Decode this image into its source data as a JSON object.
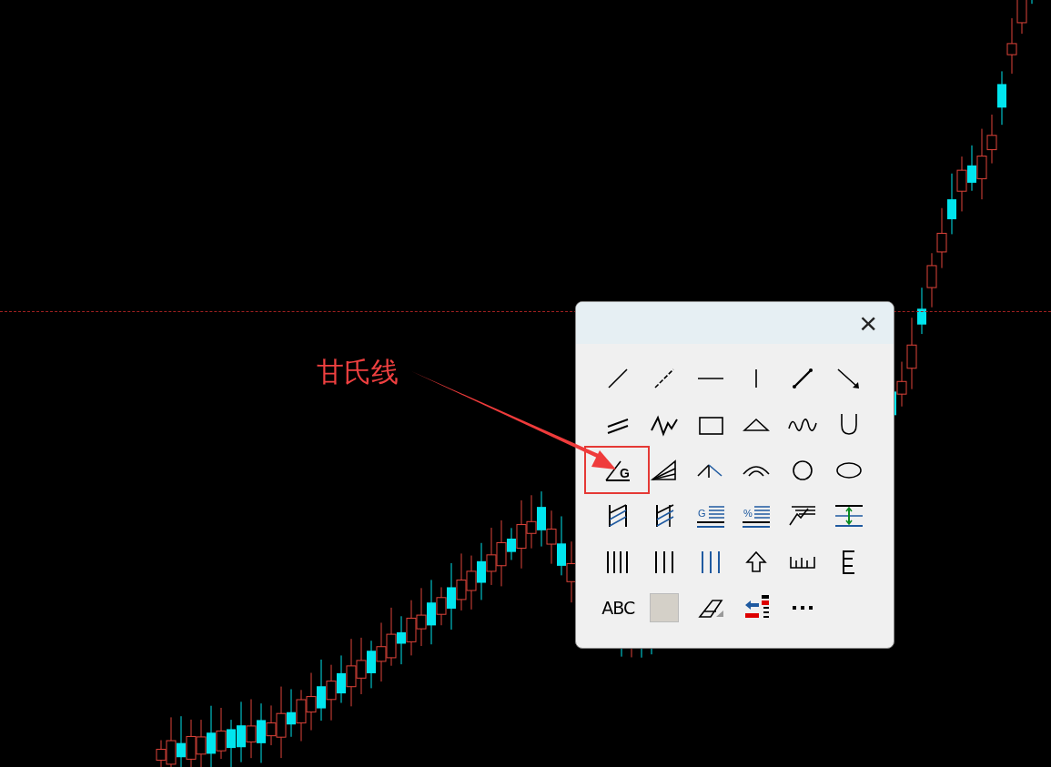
{
  "annotation": {
    "label": "甘氏线"
  },
  "palette": {
    "close_label": "×"
  },
  "tools": [
    {
      "kind": "line"
    },
    {
      "kind": "dashed-line"
    },
    {
      "kind": "horizontal"
    },
    {
      "kind": "vertical"
    },
    {
      "kind": "segment"
    },
    {
      "kind": "arrow"
    },
    {
      "kind": "parallel"
    },
    {
      "kind": "zigzag"
    },
    {
      "kind": "rectangle"
    },
    {
      "kind": "triangle"
    },
    {
      "kind": "wave"
    },
    {
      "kind": "u-shape"
    },
    {
      "kind": "gann",
      "label": "G",
      "highlighted": true
    },
    {
      "kind": "wedge"
    },
    {
      "kind": "fork"
    },
    {
      "kind": "arc"
    },
    {
      "kind": "circle"
    },
    {
      "kind": "ellipse"
    },
    {
      "kind": "channel"
    },
    {
      "kind": "channel-cross"
    },
    {
      "kind": "grid-lines",
      "label": "G"
    },
    {
      "kind": "grid-lines",
      "label": "%"
    },
    {
      "kind": "fan-lines"
    },
    {
      "kind": "band"
    },
    {
      "kind": "bars-4"
    },
    {
      "kind": "bars-3"
    },
    {
      "kind": "bars-blue"
    },
    {
      "kind": "up-arrow"
    },
    {
      "kind": "ruler"
    },
    {
      "kind": "comb"
    },
    {
      "kind": "text",
      "label": "ABC"
    },
    {
      "kind": "swatch",
      "color": "#d4d0c8"
    },
    {
      "kind": "eraser"
    },
    {
      "kind": "signals"
    },
    {
      "kind": "more"
    }
  ]
}
